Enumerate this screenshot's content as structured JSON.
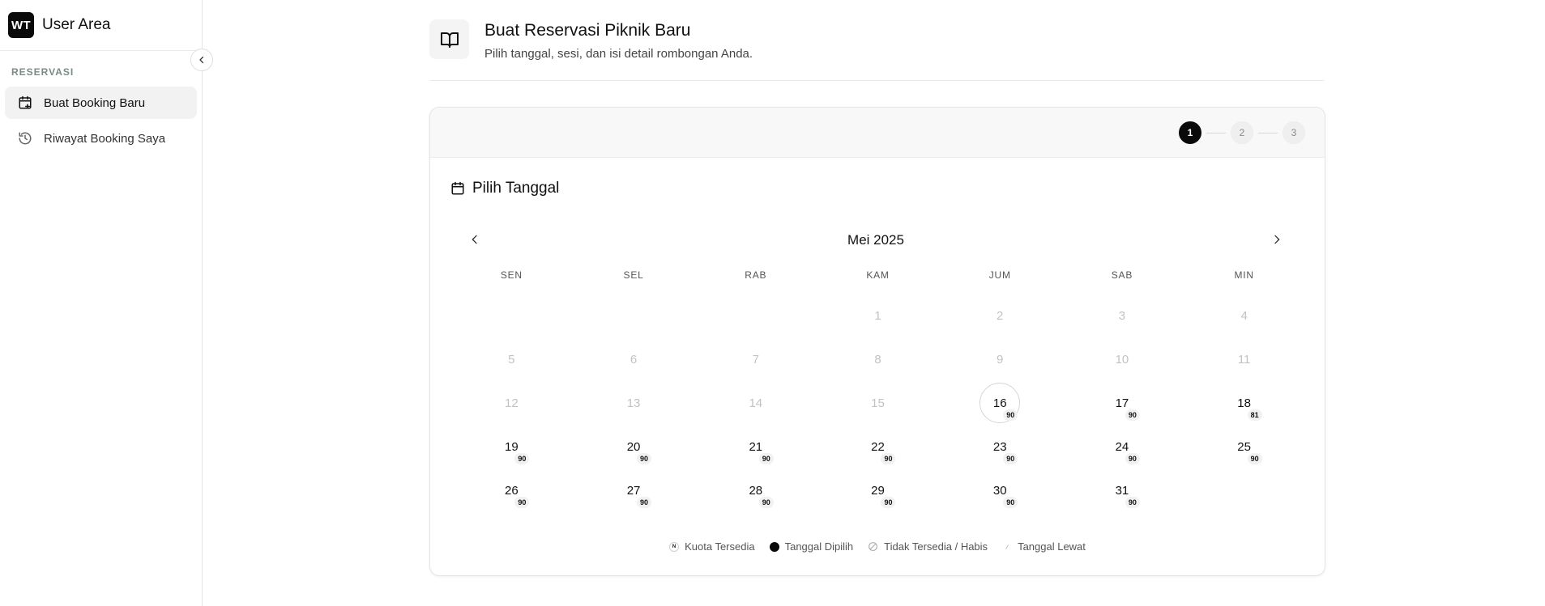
{
  "sidebar": {
    "logo": "WT",
    "title": "User Area",
    "section_label": "RESERVASI",
    "items": [
      {
        "label": "Buat Booking Baru",
        "icon": "calendar-plus-icon",
        "active": true
      },
      {
        "label": "Riwayat Booking Saya",
        "icon": "history-icon",
        "active": false
      }
    ]
  },
  "header": {
    "icon": "book-open-icon",
    "title": "Buat Reservasi Piknik Baru",
    "subtitle": "Pilih tanggal, sesi, dan isi detail rombongan Anda."
  },
  "steps": [
    "1",
    "2",
    "3"
  ],
  "active_step": "1",
  "calendar": {
    "section_title": "Pilih Tanggal",
    "month_label": "Mei 2025",
    "weekdays": [
      "SEN",
      "SEL",
      "RAB",
      "KAM",
      "JUM",
      "SAB",
      "MIN"
    ],
    "leading_blanks": 3,
    "days": [
      {
        "day": "1",
        "state": "past"
      },
      {
        "day": "2",
        "state": "past"
      },
      {
        "day": "3",
        "state": "past"
      },
      {
        "day": "4",
        "state": "past"
      },
      {
        "day": "5",
        "state": "past"
      },
      {
        "day": "6",
        "state": "past"
      },
      {
        "day": "7",
        "state": "past"
      },
      {
        "day": "8",
        "state": "past"
      },
      {
        "day": "9",
        "state": "past"
      },
      {
        "day": "10",
        "state": "past"
      },
      {
        "day": "11",
        "state": "past"
      },
      {
        "day": "12",
        "state": "past"
      },
      {
        "day": "13",
        "state": "past"
      },
      {
        "day": "14",
        "state": "past"
      },
      {
        "day": "15",
        "state": "past"
      },
      {
        "day": "16",
        "state": "today",
        "quota": "90"
      },
      {
        "day": "17",
        "state": "available",
        "quota": "90"
      },
      {
        "day": "18",
        "state": "available",
        "quota": "81"
      },
      {
        "day": "19",
        "state": "available",
        "quota": "90"
      },
      {
        "day": "20",
        "state": "available",
        "quota": "90"
      },
      {
        "day": "21",
        "state": "available",
        "quota": "90"
      },
      {
        "day": "22",
        "state": "available",
        "quota": "90"
      },
      {
        "day": "23",
        "state": "available",
        "quota": "90"
      },
      {
        "day": "24",
        "state": "available",
        "quota": "90"
      },
      {
        "day": "25",
        "state": "available",
        "quota": "90"
      },
      {
        "day": "26",
        "state": "available",
        "quota": "90"
      },
      {
        "day": "27",
        "state": "available",
        "quota": "90"
      },
      {
        "day": "28",
        "state": "available",
        "quota": "90"
      },
      {
        "day": "29",
        "state": "available",
        "quota": "90"
      },
      {
        "day": "30",
        "state": "available",
        "quota": "90"
      },
      {
        "day": "31",
        "state": "available",
        "quota": "90"
      }
    ]
  },
  "legend": [
    {
      "marker": "N",
      "label": "Kuota Tersedia",
      "icon": "quota-badge-icon"
    },
    {
      "marker": "",
      "label": "Tanggal Dipilih",
      "icon": "selected-dot-icon"
    },
    {
      "marker": "",
      "label": "Tidak Tersedia / Habis",
      "icon": "unavailable-icon"
    },
    {
      "marker": "",
      "label": "Tanggal Lewat",
      "icon": "past-slash-icon"
    }
  ],
  "colors": {
    "accent": "#0a0a0a",
    "past_text": "#c2c2c2",
    "muted_label": "#7a8a86",
    "active_nav_bg": "#f2f2f2"
  }
}
